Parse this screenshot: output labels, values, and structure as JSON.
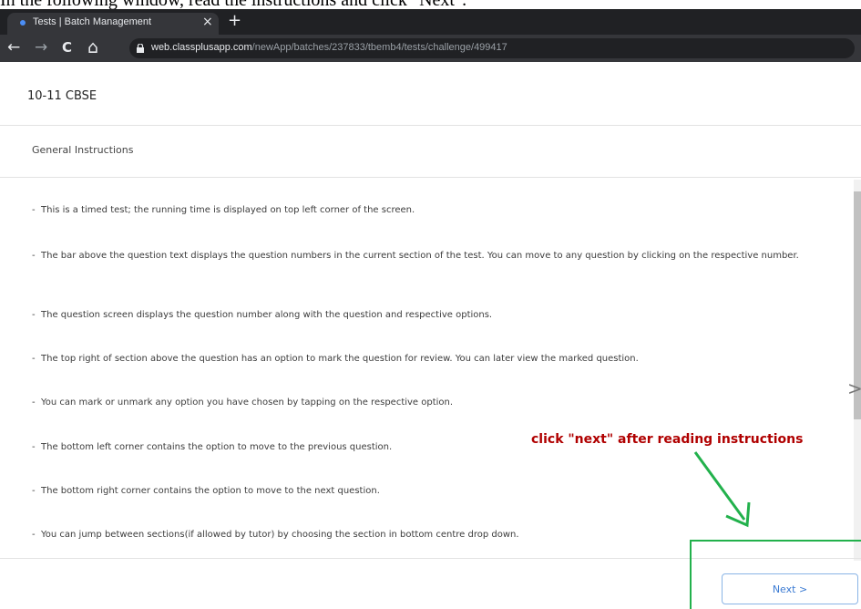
{
  "caption": "In the following window, read the instructions and click \"Next\".",
  "browser": {
    "tab_title": "Tests | Batch Management",
    "tab_close": "×",
    "new_tab": "+",
    "back": "←",
    "forward": "→",
    "reload": "C",
    "home": "⌂",
    "url_host": "web.classplusapp.com",
    "url_path": "/newApp/batches/237833/tbemb4/tests/challenge/499417"
  },
  "page": {
    "title": "10-11 CBSE",
    "section_title": "General Instructions",
    "instructions": [
      "This is a timed test; the running time is displayed on top left corner of the screen.",
      "The bar above the question text displays the question numbers in the current section of the test. You can move to any question by clicking on the respective number.",
      "The question screen displays the question number along with the question and respective options.",
      "The top right of section above the question has an option to mark the question for review. You can later view the marked question.",
      "You can mark or unmark any option you have chosen by tapping on the respective option.",
      "The bottom left corner contains the option to move to the previous question.",
      "The bottom right corner contains the option to move to the next question.",
      "You can jump between sections(if allowed by tutor) by choosing the section in bottom centre drop down."
    ],
    "bullet": "-",
    "next_label": "Next",
    "next_chevron": ">",
    "side_chevron": ">"
  },
  "annotation": {
    "text": "click \"next\" after reading instructions",
    "color": "#b00000",
    "arrow_color": "#22b14c"
  }
}
